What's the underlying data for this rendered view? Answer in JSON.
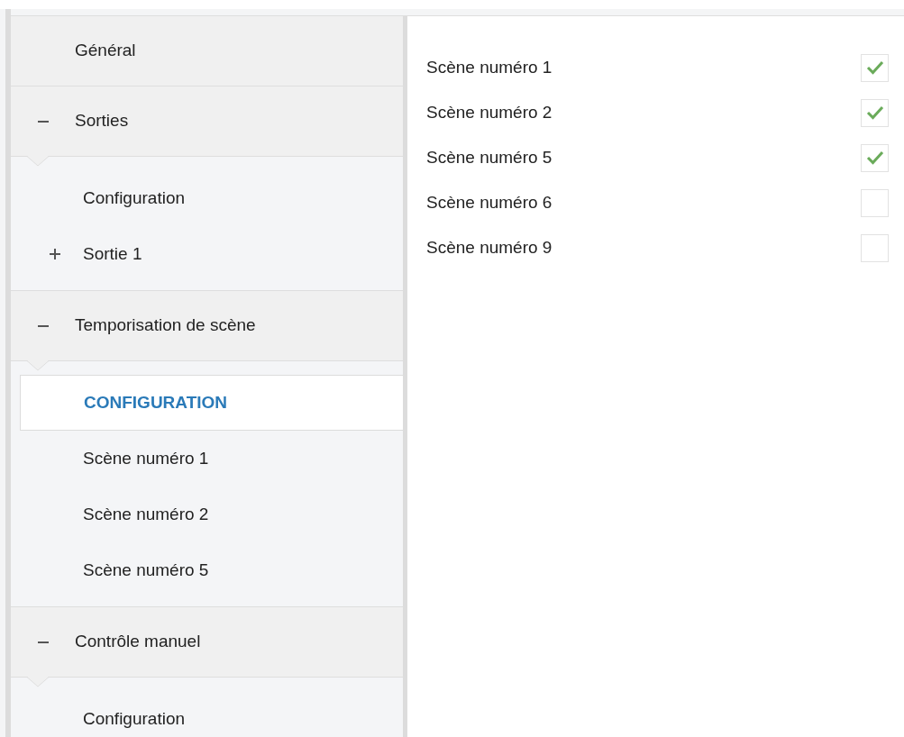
{
  "sidebar": {
    "sections": [
      {
        "label": "Général",
        "kind": "leaf"
      },
      {
        "label": "Sorties",
        "kind": "group",
        "expanded": true,
        "children": [
          {
            "label": "Configuration",
            "kind": "leaf",
            "selected": false
          },
          {
            "label": "Sortie 1",
            "kind": "group",
            "expanded": false,
            "selected": false
          }
        ]
      },
      {
        "label": "Temporisation de scène",
        "kind": "group",
        "expanded": true,
        "children": [
          {
            "label": "CONFIGURATION",
            "kind": "leaf",
            "selected": true
          },
          {
            "label": "Scène numéro 1",
            "kind": "leaf",
            "selected": false
          },
          {
            "label": "Scène numéro 2",
            "kind": "leaf",
            "selected": false
          },
          {
            "label": "Scène numéro 5",
            "kind": "leaf",
            "selected": false
          }
        ]
      },
      {
        "label": "Contrôle manuel",
        "kind": "group",
        "expanded": true,
        "children": [
          {
            "label": "Configuration",
            "kind": "leaf",
            "selected": false
          }
        ]
      }
    ]
  },
  "scenes": [
    {
      "label": "Scène numéro 1",
      "checked": true
    },
    {
      "label": "Scène numéro 2",
      "checked": true
    },
    {
      "label": "Scène numéro 5",
      "checked": true
    },
    {
      "label": "Scène numéro 6",
      "checked": false
    },
    {
      "label": "Scène numéro 9",
      "checked": false
    }
  ]
}
